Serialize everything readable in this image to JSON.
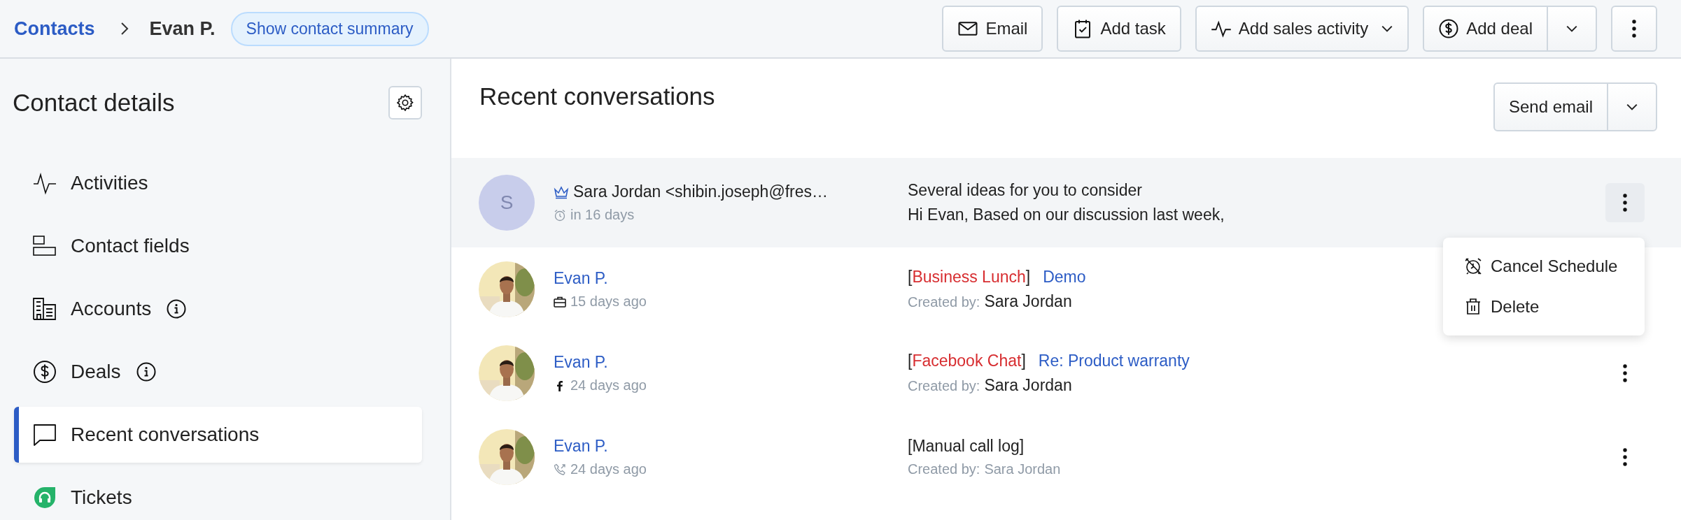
{
  "breadcrumb": {
    "root": "Contacts",
    "current": "Evan P.",
    "summary_button": "Show contact summary"
  },
  "toolbar": {
    "buttons": [
      {
        "label": "Email",
        "kind": "email"
      },
      {
        "label": "Add task",
        "kind": "task"
      },
      {
        "label": "Add sales activity",
        "kind": "activity",
        "dropdown": true
      },
      {
        "label": "Add deal",
        "kind": "deal",
        "split": true
      }
    ]
  },
  "sidebar": {
    "title": "Contact details",
    "items": [
      {
        "label": "Activities",
        "kind": "activity",
        "info": false,
        "selected": false
      },
      {
        "label": "Contact fields",
        "kind": "fields",
        "info": false,
        "selected": false
      },
      {
        "label": "Accounts",
        "kind": "accounts",
        "info": true,
        "selected": false
      },
      {
        "label": "Deals",
        "kind": "deals",
        "info": true,
        "selected": false
      },
      {
        "label": "Recent conversations",
        "kind": "conversations",
        "info": false,
        "selected": true
      },
      {
        "label": "Tickets",
        "kind": "tickets",
        "info": false,
        "selected": false
      }
    ]
  },
  "conversations": {
    "title": "Recent conversations",
    "send_button": "Send email",
    "rows": [
      {
        "kind": "scheduled",
        "avatar_letter": "S",
        "sender": "Sara Jordan <shibin.joseph@fres…",
        "time": "in 16 days",
        "subject": "Several ideas for you to consider",
        "preview": "Hi Evan, Based on our discussion last week,",
        "selected": true
      },
      {
        "kind": "meeting",
        "sender": "Evan P.",
        "time": "15 days ago",
        "tag_parts": [
          "[",
          "Business Lunch",
          "]"
        ],
        "tag_highlight": true,
        "title": "Demo",
        "created_label": "Created by:",
        "created_by": "Sara Jordan",
        "created_emphasis": true,
        "selected": false
      },
      {
        "kind": "facebook",
        "sender": "Evan P.",
        "time": "24 days ago",
        "tag_parts": [
          "[",
          "Facebook Chat",
          "]"
        ],
        "tag_highlight": true,
        "title": "Re: Product warranty",
        "created_label": "Created by:",
        "created_by": "Sara Jordan",
        "created_emphasis": true,
        "selected": false
      },
      {
        "kind": "call",
        "sender": "Evan P.",
        "time": "24 days ago",
        "tag_parts": [
          "[Manual call log]"
        ],
        "tag_highlight": false,
        "created_label": "Created by:",
        "created_by": "Sara Jordan",
        "created_emphasis": false,
        "selected": false
      }
    ],
    "menu": {
      "items": [
        {
          "label": "Cancel Schedule",
          "kind": "cancel_schedule"
        },
        {
          "label": "Delete",
          "kind": "delete"
        }
      ]
    }
  }
}
